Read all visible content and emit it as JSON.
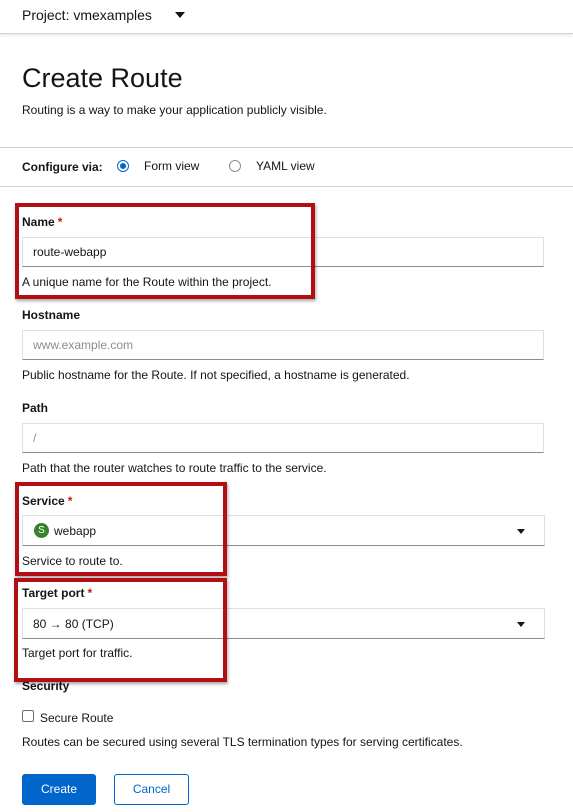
{
  "topbar": {
    "project_label": "Project: vmexamples"
  },
  "page": {
    "title": "Create Route",
    "subtitle": "Routing is a way to make your application publicly visible."
  },
  "configure": {
    "label": "Configure via:",
    "options": [
      {
        "label": "Form view",
        "selected": true
      },
      {
        "label": "YAML view",
        "selected": false
      }
    ]
  },
  "form": {
    "name": {
      "label": "Name",
      "required_mark": "*",
      "value": "route-webapp",
      "helper": "A unique name for the Route within the project."
    },
    "hostname": {
      "label": "Hostname",
      "value": "",
      "placeholder": "www.example.com",
      "helper": "Public hostname for the Route. If not specified, a hostname is generated."
    },
    "path": {
      "label": "Path",
      "value": "",
      "placeholder": "/",
      "helper": "Path that the router watches to route traffic to the service."
    },
    "service": {
      "label": "Service",
      "required_mark": "*",
      "badge": "S",
      "value": "webapp",
      "helper": "Service to route to."
    },
    "target_port": {
      "label": "Target port",
      "required_mark": "*",
      "value": "80 → 80 (TCP)",
      "helper": "Target port for traffic."
    },
    "security": {
      "label": "Security",
      "checkbox_label": "Secure Route",
      "checked": false,
      "helper": "Routes can be secured using several TLS termination types for serving certificates."
    }
  },
  "actions": {
    "create_label": "Create",
    "cancel_label": "Cancel"
  },
  "colors": {
    "accent": "#0066cc",
    "required": "#c9190b",
    "highlight": "#b10f13",
    "service_badge": "#38812f"
  },
  "icons": {
    "project_dropdown": "caret-down-icon",
    "select_dropdown": "caret-down-icon"
  }
}
